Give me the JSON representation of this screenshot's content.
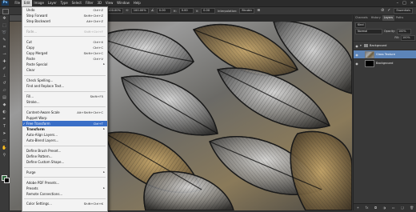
{
  "app": {
    "logo": "Ps"
  },
  "menubar": {
    "items": [
      "File",
      "Edit",
      "Image",
      "Layer",
      "Type",
      "Select",
      "Filter",
      "3D",
      "View",
      "Window",
      "Help"
    ],
    "active_index": 1
  },
  "window_controls": {
    "minimize": "–",
    "maximize": "□",
    "close": "✕"
  },
  "options_bar": {
    "x_label": "X:",
    "x_value": "",
    "y_label": "Y:",
    "y_value": "",
    "w_label": "W:",
    "w_value": "100.00%",
    "h_label": "H:",
    "h_value": "100.00%",
    "angle_value": "0.00",
    "h_skew_label": "H:",
    "h_skew_value": "0.00",
    "v_skew_label": "V:",
    "v_skew_value": "0.00",
    "interpolation_label": "Interpolation:",
    "interpolation_value": "Bicubic",
    "workspace": "Essentials"
  },
  "document": {
    "tab_title": ""
  },
  "edit_menu": {
    "groups": [
      [
        {
          "label": "Undo",
          "shortcut": "Ctrl+Z",
          "state": "normal"
        },
        {
          "label": "Step Forward",
          "shortcut": "Shift+Ctrl+Z",
          "state": "normal"
        },
        {
          "label": "Step Backward",
          "shortcut": "Alt+Ctrl+Z",
          "state": "normal"
        }
      ],
      [
        {
          "label": "Fade...",
          "shortcut": "Shift+Ctrl+F",
          "state": "disabled"
        }
      ],
      [
        {
          "label": "Cut",
          "shortcut": "Ctrl+X",
          "state": "normal"
        },
        {
          "label": "Copy",
          "shortcut": "Ctrl+C",
          "state": "normal"
        },
        {
          "label": "Copy Merged",
          "shortcut": "Shift+Ctrl+C",
          "state": "normal"
        },
        {
          "label": "Paste",
          "shortcut": "Ctrl+V",
          "state": "normal"
        },
        {
          "label": "Paste Special",
          "shortcut": "",
          "state": "normal",
          "submenu": true
        },
        {
          "label": "Clear",
          "shortcut": "",
          "state": "normal"
        }
      ],
      [
        {
          "label": "Check Spelling...",
          "shortcut": "",
          "state": "normal"
        },
        {
          "label": "Find and Replace Text...",
          "shortcut": "",
          "state": "normal"
        }
      ],
      [
        {
          "label": "Fill...",
          "shortcut": "Shift+F5",
          "state": "normal"
        },
        {
          "label": "Stroke...",
          "shortcut": "",
          "state": "normal"
        }
      ],
      [
        {
          "label": "Content-Aware Scale",
          "shortcut": "Alt+Shift+Ctrl+C",
          "state": "normal"
        },
        {
          "label": "Puppet Warp",
          "shortcut": "",
          "state": "normal"
        },
        {
          "label": "Free Transform",
          "shortcut": "Ctrl+T",
          "state": "highlighted",
          "checked": true
        },
        {
          "label": "Transform",
          "shortcut": "",
          "state": "bold",
          "submenu": true
        },
        {
          "label": "Auto-Align Layers...",
          "shortcut": "",
          "state": "normal"
        },
        {
          "label": "Auto-Blend Layers...",
          "shortcut": "",
          "state": "normal"
        }
      ],
      [
        {
          "label": "Define Brush Preset...",
          "shortcut": "",
          "state": "normal"
        },
        {
          "label": "Define Pattern...",
          "shortcut": "",
          "state": "normal"
        },
        {
          "label": "Define Custom Shape...",
          "shortcut": "",
          "state": "normal"
        }
      ],
      [
        {
          "label": "Purge",
          "shortcut": "",
          "state": "normal",
          "submenu": true
        }
      ],
      [
        {
          "label": "Adobe PDF Presets...",
          "shortcut": "",
          "state": "normal"
        },
        {
          "label": "Presets",
          "shortcut": "",
          "state": "normal",
          "submenu": true
        },
        {
          "label": "Remote Connections...",
          "shortcut": "",
          "state": "normal"
        }
      ],
      [
        {
          "label": "Color Settings...",
          "shortcut": "Shift+Ctrl+K",
          "state": "normal"
        }
      ]
    ]
  },
  "layers_panel": {
    "tabs": [
      "Channels",
      "History",
      "Layers",
      "Paths"
    ],
    "active_tab": 2,
    "filter_kind": "Kind",
    "blend_mode": "Normal",
    "opacity_label": "Opacity:",
    "opacity_value": "100%",
    "fill_label": "Fill:",
    "fill_value": "100%",
    "layers": [
      {
        "name": "Background",
        "type": "group",
        "selected": false
      },
      {
        "name": "Glass Texture",
        "type": "image",
        "selected": true
      },
      {
        "name": "Background",
        "type": "black",
        "selected": false
      }
    ]
  },
  "colors": {
    "menu_highlight": "#3a6fc7",
    "layer_selected": "#5c84b8",
    "foreground_swatch": "#2d6b3d",
    "background_swatch": "#000000"
  }
}
